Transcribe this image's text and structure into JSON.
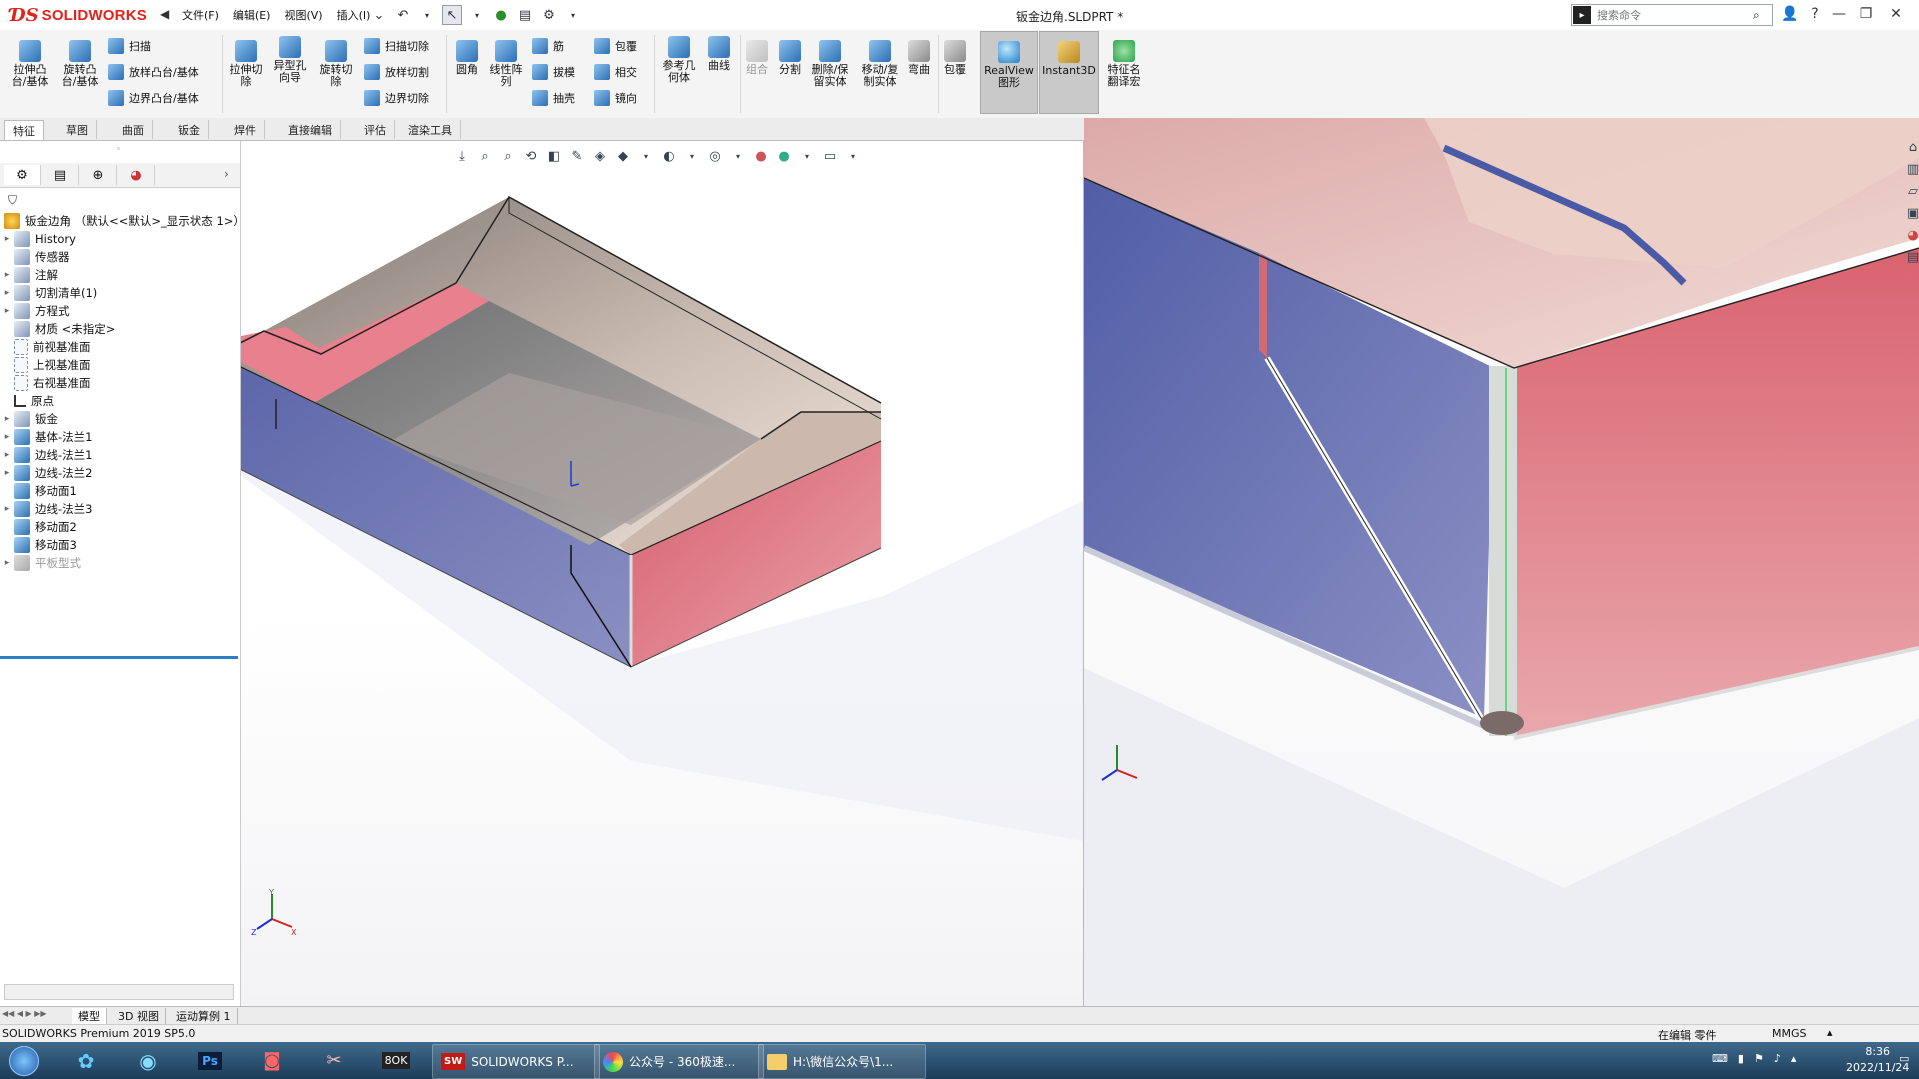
{
  "app": {
    "brand_ds": "ƊS",
    "brand_text": "SOLIDWORKS",
    "doc_title": "钣金边角.SLDPRT *",
    "menu": [
      "文件(F)",
      "编辑(E)",
      "视图(V)",
      "插入(I)"
    ],
    "search_placeholder": "搜索命令"
  },
  "ribbon": {
    "extrude_boss": "拉伸凸\n台/基体",
    "revolve_boss": "旋转凸\n台/基体",
    "sweep": "扫描",
    "loft_boss": "放样凸台/基体",
    "boundary_boss": "边界凸台/基体",
    "extrude_cut": "拉伸切\n除",
    "hole_wizard": "异型孔\n向导",
    "revolve_cut": "旋转切\n除",
    "swept_cut": "扫描切除",
    "lofted_cut": "放样切割",
    "boundary_cut": "边界切除",
    "fillet": "圆角",
    "linear_pattern": "线性阵\n列",
    "rib": "筋",
    "draft": "拔模",
    "shell": "抽壳",
    "wrap": "包覆",
    "intersect": "相交",
    "mirror": "镜向",
    "ref_geometry": "参考几\n何体",
    "curves": "曲线",
    "combine": "组合",
    "split": "分割",
    "delete_body": "删除/保\n留实体",
    "move_copy": "移动/复\n制实体",
    "flex": "弯曲",
    "wrap2": "包覆",
    "realview": "RealView\n图形",
    "instant3d": "Instant3D",
    "feature_translate": "特征名\n翻译宏"
  },
  "command_tabs": [
    "特征",
    "草图",
    "曲面",
    "钣金",
    "焊件",
    "直接编辑",
    "评估",
    "渲染工具"
  ],
  "tree": {
    "root": "钣金边角 （默认<<默认>_显示状态 1>）",
    "items": [
      {
        "label": "History",
        "arrow": "▸",
        "icon": "folder"
      },
      {
        "label": "传感器",
        "arrow": "",
        "icon": "folder"
      },
      {
        "label": "注解",
        "arrow": "▸",
        "icon": "folder"
      },
      {
        "label": "切割清单(1)",
        "arrow": "▸",
        "icon": "folder"
      },
      {
        "label": "方程式",
        "arrow": "▸",
        "icon": "folder"
      },
      {
        "label": "材质 <未指定>",
        "arrow": "",
        "icon": "folder"
      },
      {
        "label": "前视基准面",
        "arrow": "",
        "icon": "plane"
      },
      {
        "label": "上视基准面",
        "arrow": "",
        "icon": "plane"
      },
      {
        "label": "右视基准面",
        "arrow": "",
        "icon": "plane"
      },
      {
        "label": "原点",
        "arrow": "",
        "icon": "origin"
      },
      {
        "label": "钣金",
        "arrow": "▸",
        "icon": "folder"
      },
      {
        "label": "基体-法兰1",
        "arrow": "▸",
        "icon": "feature"
      },
      {
        "label": "边线-法兰1",
        "arrow": "▸",
        "icon": "feature"
      },
      {
        "label": "边线-法兰2",
        "arrow": "▸",
        "icon": "feature"
      },
      {
        "label": "移动面1",
        "arrow": "",
        "icon": "feature"
      },
      {
        "label": "边线-法兰3",
        "arrow": "▸",
        "icon": "feature"
      },
      {
        "label": "移动面2",
        "arrow": "",
        "icon": "feature"
      },
      {
        "label": "移动面3",
        "arrow": "",
        "icon": "feature"
      },
      {
        "label": "平板型式",
        "arrow": "▸",
        "icon": "flat"
      }
    ]
  },
  "bottom_tabs": [
    "模型",
    "3D 视图",
    "运动算例 1"
  ],
  "status": {
    "product": "SOLIDWORKS Premium 2019 SP5.0",
    "editing": "在编辑 零件",
    "units": "MMGS"
  },
  "taskbar": {
    "tasks": [
      "SOLIDWORKS P...",
      "公众号 - 360极速...",
      "H:\\微信公众号\\1..."
    ],
    "time": "8:36",
    "date": "2022/11/24"
  },
  "colors": {
    "brand": "#e2231a",
    "face_blue": "#6e78b8",
    "face_pink": "#e07a86",
    "face_tan": "#c9b8ae"
  }
}
